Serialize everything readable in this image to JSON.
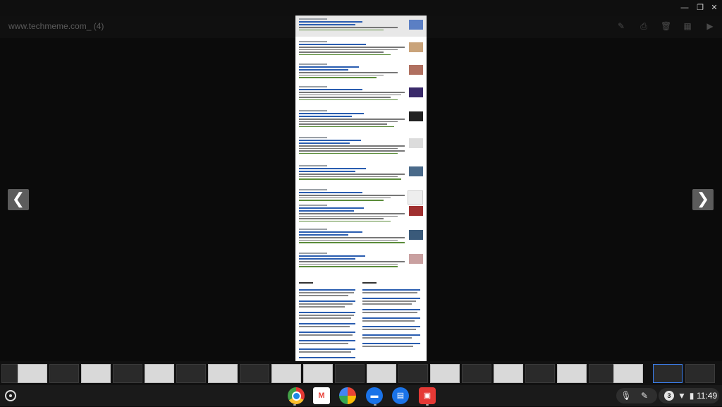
{
  "window": {
    "minimize_icon": "minimize-icon",
    "maximize_icon": "restore-icon",
    "close_icon": "close-icon"
  },
  "viewer": {
    "title": "www.techmeme.com_ (4)",
    "tools": [
      "edit-icon",
      "print-icon",
      "delete-icon",
      "grid-icon",
      "slideshow-icon"
    ]
  },
  "navigation": {
    "prev_glyph": "❮",
    "next_glyph": "❯"
  },
  "shelf": {
    "apps": [
      {
        "name": "chrome",
        "color": "#e53935"
      },
      {
        "name": "gmail",
        "color": "#e8453c"
      },
      {
        "name": "photos",
        "color": "#34a853"
      },
      {
        "name": "files",
        "color": "#1a73e8"
      },
      {
        "name": "messages",
        "color": "#1a73e8"
      },
      {
        "name": "gallery",
        "color": "#e53935"
      }
    ],
    "notification_count": "3",
    "time": "11:49"
  },
  "colors": {
    "link": "#2a5db0",
    "meta": "#5b8c3a",
    "accent": "#3b82f6"
  }
}
